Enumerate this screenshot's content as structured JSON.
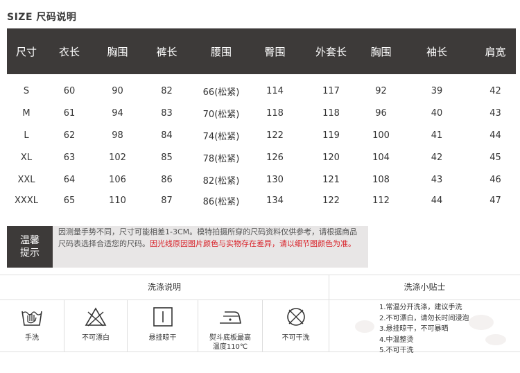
{
  "title": "SIZE 尺码说明",
  "size_table": {
    "headers": [
      "尺寸",
      "衣长",
      "胸围",
      "裤长",
      "腰围",
      "臀围",
      "外套长",
      "胸围",
      "袖长",
      "肩宽"
    ],
    "rows": [
      [
        "S",
        "60",
        "90",
        "82",
        "66(松紧)",
        "114",
        "117",
        "92",
        "39",
        "42"
      ],
      [
        "M",
        "61",
        "94",
        "83",
        "70(松紧)",
        "118",
        "118",
        "96",
        "40",
        "43"
      ],
      [
        "L",
        "62",
        "98",
        "84",
        "74(松紧)",
        "122",
        "119",
        "100",
        "41",
        "44"
      ],
      [
        "XL",
        "63",
        "102",
        "85",
        "78(松紧)",
        "126",
        "120",
        "104",
        "42",
        "45"
      ],
      [
        "XXL",
        "64",
        "106",
        "86",
        "82(松紧)",
        "130",
        "121",
        "108",
        "43",
        "46"
      ],
      [
        "XXXL",
        "65",
        "110",
        "87",
        "86(松紧)",
        "134",
        "122",
        "112",
        "44",
        "47"
      ]
    ]
  },
  "tip": {
    "label_line1": "温馨",
    "label_line2": "提示",
    "text_normal": "因测量手势不同，尺寸可能相差1-3CM。模特拍摄所穿的尺码资料仅供参考，请根据商品尺码表选择合适您的尺码。",
    "text_red": "因光线原因图片颜色与实物存在差异，请以细节图颜色为准。"
  },
  "care": {
    "instructions_title": "洗涤说明",
    "tips_title": "洗涤小贴士",
    "items": [
      {
        "icon": "hand-wash-icon",
        "label": "手洗"
      },
      {
        "icon": "no-bleach-icon",
        "label": "不可漂白"
      },
      {
        "icon": "hang-dry-icon",
        "label": "悬挂晾干"
      },
      {
        "icon": "iron-icon",
        "label_line1": "熨斗底板最高",
        "label_line2": "温度110℃"
      },
      {
        "icon": "no-dry-clean-icon",
        "label": "不可干洗"
      }
    ],
    "tips": [
      "1.常温分开洗涤，建议手洗",
      "2.不可漂白，请勿长时间浸泡",
      "3.悬挂晾干，不可暴晒",
      "4.中温整烫",
      "5.不可干洗"
    ]
  },
  "colors": {
    "header_bg": "#3d3a39",
    "tip_bg": "#e8e6e6",
    "accent_red": "#d9232a"
  }
}
